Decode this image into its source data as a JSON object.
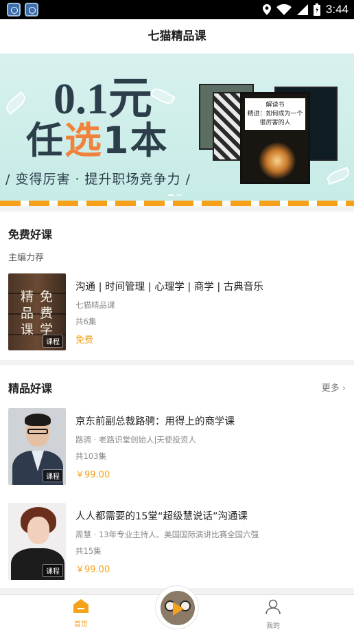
{
  "status_bar": {
    "time": "3:44"
  },
  "header": {
    "title": "七猫精品课"
  },
  "banner": {
    "price_text": "0.1元",
    "headline_prefix": "任",
    "headline_accent": "选",
    "headline_suffix": "1本",
    "tagline": "/ 变得厉害 · 提升职场竞争力 /",
    "featured_book_title": "精进：如何成为一个很厉害的人",
    "featured_book_label": "解读书",
    "slide_index": 1,
    "slide_count": 2
  },
  "free_section": {
    "title": "免费好课",
    "subtitle": "主编力荐",
    "course": {
      "cover_text": [
        "精",
        "品",
        "课",
        "免",
        "费",
        "学"
      ],
      "tag": "课程",
      "title": "沟通 | 时间管理 | 心理学 | 商学 | 古典音乐",
      "author": "七猫精品课",
      "episodes": "共6集",
      "price": "免费"
    }
  },
  "premium_section": {
    "title": "精品好课",
    "more_label": "更多",
    "courses": [
      {
        "tag": "课程",
        "title": "京东前副总裁路骋：用得上的商学课",
        "author": "路骋 · 老路识堂创始人|天使投资人",
        "episodes": "共103集",
        "price": "￥99.00"
      },
      {
        "tag": "课程",
        "title": "人人都需要的15堂“超级慧说话”沟通课",
        "author": "周慧 · 13年专业主持人、美国国际演讲比赛全国六强",
        "episodes": "共15集",
        "price": "￥99.00"
      }
    ]
  },
  "tab_bar": {
    "home_label": "首页",
    "me_label": "我的"
  },
  "colors": {
    "accent": "#f5a21a",
    "banner_bg": "#c6ebe6",
    "headline_accent": "#f0823c"
  }
}
